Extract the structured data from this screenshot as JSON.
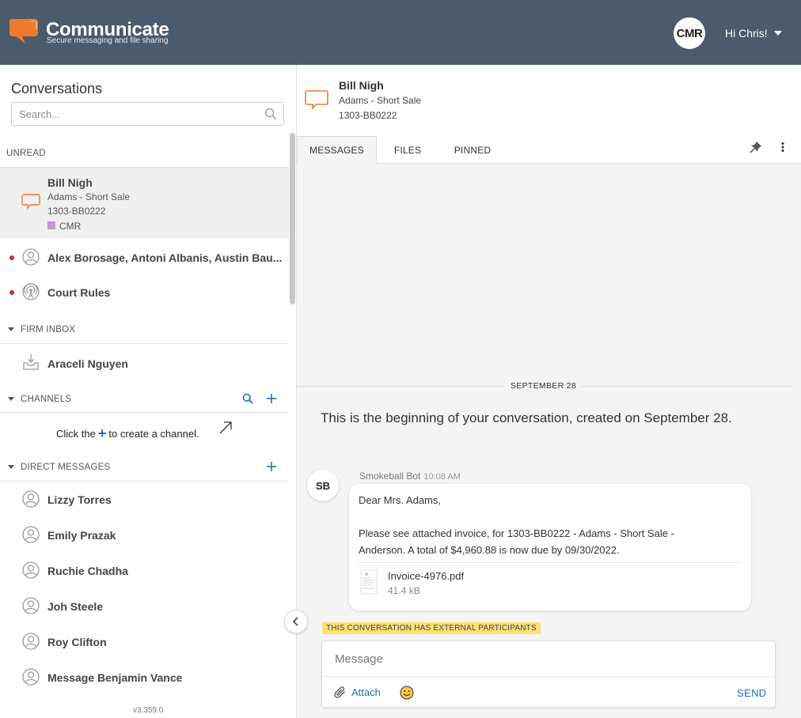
{
  "app": {
    "name": "Communicate",
    "tagline": "Secure messaging and file sharing",
    "user_initials": "CMR",
    "greeting": "Hi Chris!"
  },
  "sidebar": {
    "title": "Conversations",
    "search_placeholder": "Search...",
    "unread_label": "UNREAD",
    "unread": [
      {
        "name": "Bill Nigh",
        "line1": "Adams - Short Sale",
        "line2": "1303-BB0222",
        "tag": "CMR"
      },
      {
        "name": "Alex Borosage, Antoni Albanis, Austin Bau..."
      },
      {
        "name": "Court Rules"
      }
    ],
    "firm_inbox_label": "FIRM INBOX",
    "firm_inbox": [
      {
        "name": "Araceli Nguyen"
      }
    ],
    "channels_label": "CHANNELS",
    "channels_hint_before": "Click the",
    "channels_hint_after": "to create a channel.",
    "dm_label": "DIRECT MESSAGES",
    "direct_messages": [
      {
        "name": "Lizzy Torres"
      },
      {
        "name": "Emily Prazak"
      },
      {
        "name": "Ruchie Chadha"
      },
      {
        "name": "Joh Steele"
      },
      {
        "name": "Roy Clifton"
      },
      {
        "name": "Message Benjamin Vance"
      }
    ],
    "version": "v3.359.0"
  },
  "conversation": {
    "name": "Bill Nigh",
    "matter": "Adams - Short Sale",
    "matter_id": "1303-BB0222",
    "tabs": [
      "MESSAGES",
      "FILES",
      "PINNED"
    ],
    "date_separator": "SEPTEMBER 28",
    "beginning_text": "This is the beginning of your conversation, created on September 28.",
    "message": {
      "avatar": "SB",
      "sender": "Smokeball Bot",
      "time": "10:08 AM",
      "line1": "Dear Mrs. Adams,",
      "line2": "Please see attached invoice, for 1303-BB0222 - Adams - Short Sale -",
      "line3": "Anderson. A total of $4,960.88 is now due by 09/30/2022.",
      "attachment_name": "Invoice-4976.pdf",
      "attachment_size": "41.4 kB"
    },
    "external_notice": "THIS CONVERSATION HAS EXTERNAL PARTICIPANTS",
    "composer_placeholder": "Message",
    "attach_label": "Attach",
    "send_label": "SEND"
  },
  "colors": {
    "header_bg": "#4b5a6c",
    "brand_orange": "#f07a2b",
    "accent_blue": "#1f70c1",
    "unread_red": "#d9262e",
    "notice_yellow": "#fbe073"
  }
}
